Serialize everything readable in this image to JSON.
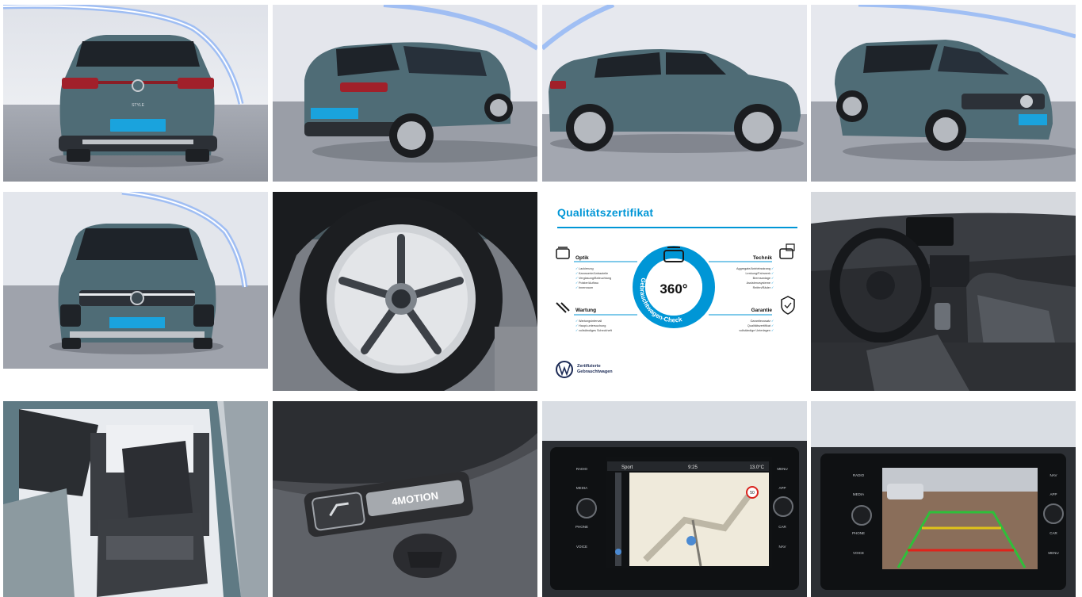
{
  "gallery": {
    "tiles": [
      {
        "kind": "photo",
        "view": "rear"
      },
      {
        "kind": "photo",
        "view": "rear-three-quarter"
      },
      {
        "kind": "photo",
        "view": "side"
      },
      {
        "kind": "photo",
        "view": "front-three-quarter"
      },
      {
        "kind": "photo",
        "view": "front"
      },
      {
        "kind": "photo",
        "view": "wheel"
      },
      {
        "kind": "certificate"
      },
      {
        "kind": "photo",
        "view": "cockpit"
      },
      {
        "kind": "photo",
        "view": "front-seats"
      },
      {
        "kind": "photo",
        "view": "trunk-button"
      },
      {
        "kind": "photo",
        "view": "navigation-screen"
      },
      {
        "kind": "photo",
        "view": "rear-camera-screen"
      }
    ]
  },
  "car": {
    "rear_model_badge": "STYLE",
    "trunk_badge": "4MOTION"
  },
  "certificate": {
    "title": "Qualitätszertifikat",
    "badge_number": "360°",
    "badge_arc_text": "Gebrauchtwagen-Check",
    "sections": {
      "optik": {
        "heading": "Optik",
        "items": [
          "Lackierung",
          "Karosserie/Anbauteile",
          "Verglasung/Beleuchtung",
          "Polster/Aufbau",
          "Innenraum"
        ]
      },
      "wartung": {
        "heading": "Wartung",
        "items": [
          "Wartungsintervall",
          "Haupt-untersuchung",
          "vollständiges Scheckheft"
        ]
      },
      "technik": {
        "heading": "Technik",
        "items": [
          "Aggregate/Antriebsstrang",
          "Lenkung/Fahrwerk",
          "Bremsanlage",
          "Assistenzsysteme",
          "Reifen/Räder"
        ]
      },
      "garantie": {
        "heading": "Garantie",
        "items": [
          "Garantiezusatz",
          "Qualitätszertifikat",
          "vollständige Unterlagen"
        ]
      }
    },
    "footer_line1": "Zertifizierte",
    "footer_line2": "Gebrauchtwagen"
  },
  "navigation_screen": {
    "top_left": "Sport",
    "time": "9:25",
    "temp": "13.0°C",
    "left_keys": [
      "RADIO",
      "MEDIA",
      "PHONE",
      "VOICE"
    ],
    "right_keys": [
      "MENU",
      "APP",
      "CAR",
      "NAV"
    ],
    "speed_sign": "50"
  },
  "camera_screen": {
    "left_keys": [
      "RADIO",
      "MEDIA",
      "PHONE",
      "VOICE"
    ],
    "right_keys": [
      "NAV",
      "APP",
      "CAR",
      "MENU"
    ]
  },
  "colors": {
    "car_body": "#4f6c76",
    "showroom_wall": "#e6e8ee",
    "showroom_floor": "#9ea2ab",
    "led_strip": "#6f98e6",
    "cert_accent": "#0096d6",
    "cert_badge": "#0096d6"
  }
}
